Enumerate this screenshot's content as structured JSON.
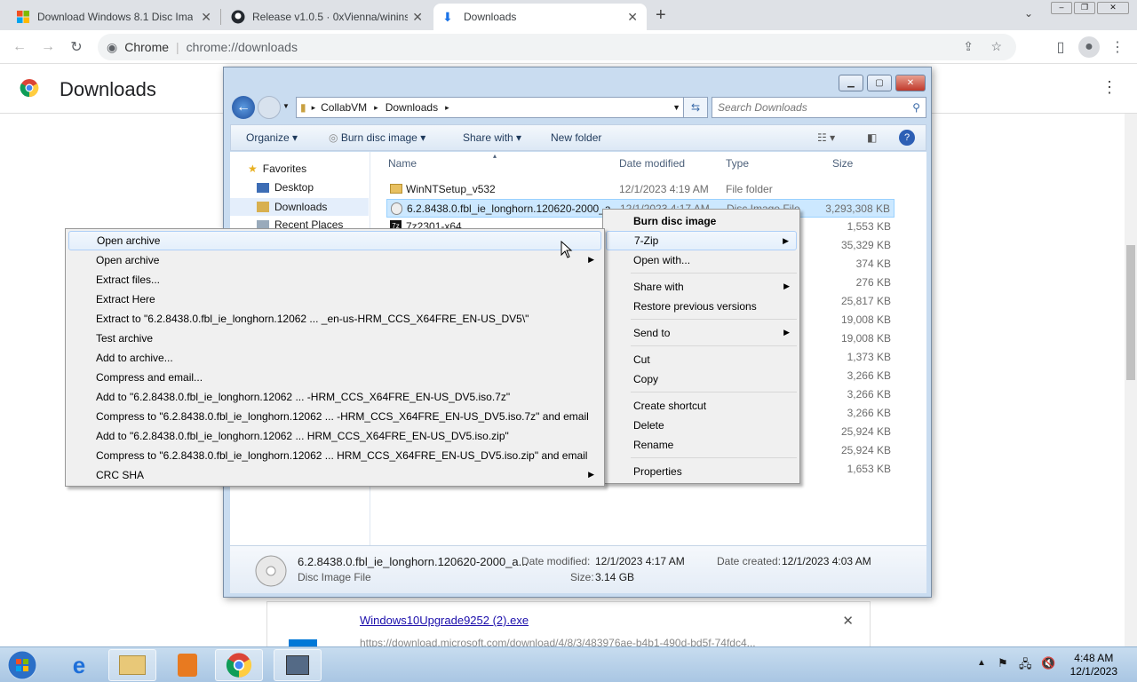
{
  "browser": {
    "tabs": [
      {
        "title": "Download Windows 8.1 Disc Ima",
        "favicon": "windows-icon"
      },
      {
        "title": "Release v1.0.5 · 0xVienna/winins",
        "favicon": "github-icon"
      },
      {
        "title": "Downloads",
        "favicon": "download-icon"
      }
    ],
    "site_label": "Chrome",
    "url": "chrome://downloads"
  },
  "downloads_page": {
    "title": "Downloads",
    "item": {
      "filename": "Windows10Upgrade9252 (2).exe",
      "url": "https://download.microsoft.com/download/4/8/3/483976ae-b4b1-490d-bd5f-74fdc4..."
    }
  },
  "explorer": {
    "breadcrumb": [
      "CollabVM",
      "Downloads"
    ],
    "search_placeholder": "Search Downloads",
    "commands": [
      "Organize",
      "Burn disc image",
      "Share with",
      "New folder"
    ],
    "nav": [
      {
        "label": "Favorites"
      },
      {
        "label": "Desktop"
      },
      {
        "label": "Downloads"
      },
      {
        "label": "Recent Places"
      }
    ],
    "columns": [
      "Name",
      "Date modified",
      "Type",
      "Size"
    ],
    "rows": [
      {
        "name": "WinNTSetup_v532",
        "date": "12/1/2023 4:19 AM",
        "type": "File folder",
        "size": ""
      },
      {
        "name": "6.2.8438.0.fbl_ie_longhorn.120620-2000_a...",
        "date": "12/1/2023 4:17 AM",
        "type": "Disc Image File",
        "size": "3,293,308 KB"
      },
      {
        "name": "7z2301-x64",
        "date": "",
        "type": "",
        "size": "1,553 KB"
      },
      {
        "name": "",
        "date": "",
        "type": "",
        "size": "35,329 KB"
      },
      {
        "name": "",
        "date": "",
        "type": "",
        "size": "374 KB"
      },
      {
        "name": "",
        "date": "",
        "type": "",
        "size": "276 KB"
      },
      {
        "name": "",
        "date": "",
        "type": "",
        "size": "25,817 KB"
      },
      {
        "name": "",
        "date": "",
        "type": "",
        "size": "19,008 KB"
      },
      {
        "name": "",
        "date": "",
        "type": "",
        "size": "19,008 KB"
      },
      {
        "name": "",
        "date": "",
        "type": "",
        "size": "1,373 KB"
      },
      {
        "name": "",
        "date": "",
        "type": "",
        "size": "3,266 KB"
      },
      {
        "name": "",
        "date": "",
        "type": "",
        "size": "3,266 KB"
      },
      {
        "name": "",
        "date": "",
        "type": "",
        "size": "3,266 KB"
      },
      {
        "name": "",
        "date": "",
        "type": "",
        "size": "25,924 KB"
      },
      {
        "name": "",
        "date": "",
        "type": "",
        "size": "25,924 KB"
      },
      {
        "name": "",
        "date": "",
        "type": "",
        "size": "1,653 KB"
      }
    ],
    "details": {
      "filename": "6.2.8438.0.fbl_ie_longhorn.120620-2000_a...",
      "type": "Disc Image File",
      "date_modified_label": "Date modified:",
      "date_modified": "12/1/2023 4:17 AM",
      "date_created_label": "Date created:",
      "date_created": "12/1/2023 4:03 AM",
      "size_label": "Size:",
      "size": "3.14 GB"
    }
  },
  "context_menu": {
    "items": [
      "Burn disc image",
      "7-Zip",
      "Open with...",
      "Share with",
      "Restore previous versions",
      "Send to",
      "Cut",
      "Copy",
      "Create shortcut",
      "Delete",
      "Rename",
      "Properties"
    ]
  },
  "zip_submenu": {
    "items": [
      "Open archive",
      "Open archive",
      "Extract files...",
      "Extract Here",
      "Extract to \"6.2.8438.0.fbl_ie_longhorn.12062 ... _en-us-HRM_CCS_X64FRE_EN-US_DV5\\\"",
      "Test archive",
      "Add to archive...",
      "Compress and email...",
      "Add to \"6.2.8438.0.fbl_ie_longhorn.12062 ... -HRM_CCS_X64FRE_EN-US_DV5.iso.7z\"",
      "Compress to \"6.2.8438.0.fbl_ie_longhorn.12062 ... -HRM_CCS_X64FRE_EN-US_DV5.iso.7z\" and email",
      "Add to \"6.2.8438.0.fbl_ie_longhorn.12062 ... HRM_CCS_X64FRE_EN-US_DV5.iso.zip\"",
      "Compress to \"6.2.8438.0.fbl_ie_longhorn.12062 ... HRM_CCS_X64FRE_EN-US_DV5.iso.zip\" and email",
      "CRC SHA"
    ]
  },
  "taskbar": {
    "time": "4:48 AM",
    "date": "12/1/2023"
  }
}
